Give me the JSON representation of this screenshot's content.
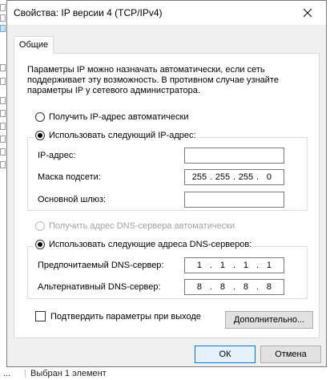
{
  "background": {
    "status_bar": {
      "part1": "...",
      "part2": "Выбран 1 элемент"
    }
  },
  "dialog": {
    "title": "Свойства: IP версии 4 (TCP/IPv4)",
    "tab_general": "Общие",
    "description": "Параметры IP можно назначать автоматически, если сеть поддерживает эту возможность. В противном случае узнайте параметры IP у сетевого администратора.",
    "ip": {
      "auto_label": "Получить IP-адрес автоматически",
      "manual_label": "Использовать следующий IP-адрес:",
      "selected": "manual",
      "ip_address_label": "IP-адрес:",
      "ip_address": [
        "",
        "",
        "",
        ""
      ],
      "subnet_label": "Маска подсети:",
      "subnet": [
        "255",
        "255",
        "255",
        "0"
      ],
      "gateway_label": "Основной шлюз:",
      "gateway": [
        "",
        "",
        "",
        ""
      ]
    },
    "dns": {
      "auto_label": "Получить адрес DNS-сервера автоматически",
      "manual_label": "Использовать следующие адреса DNS-серверов:",
      "selected": "manual",
      "preferred_label": "Предпочитаемый DNS-сервер:",
      "preferred": [
        "1",
        "1",
        "1",
        "1"
      ],
      "alternate_label": "Альтернативный DNS-сервер:",
      "alternate": [
        "8",
        "8",
        "8",
        "8"
      ]
    },
    "validate_label": "Подтвердить параметры при выходе",
    "validate_checked": false,
    "advanced_button": "Дополнительно...",
    "ok_button": "ОК",
    "cancel_button": "Отмена"
  }
}
